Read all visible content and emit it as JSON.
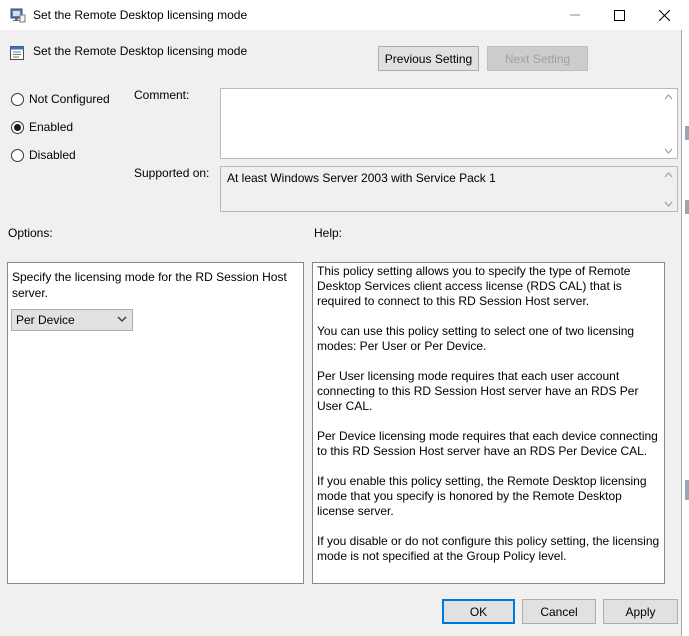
{
  "window": {
    "title": "Set the Remote Desktop licensing mode",
    "controls": {
      "minimize": "—",
      "maximize": "□",
      "close": "✕"
    }
  },
  "header": {
    "title": "Set the Remote Desktop licensing mode",
    "previous_label": "Previous Setting",
    "next_label": "Next Setting"
  },
  "state": {
    "options": [
      "Not Configured",
      "Enabled",
      "Disabled"
    ],
    "selected": "Enabled"
  },
  "comment": {
    "label": "Comment:",
    "value": ""
  },
  "supported": {
    "label": "Supported on:",
    "value": "At least Windows Server 2003 with Service Pack 1"
  },
  "options_section": {
    "label": "Options:",
    "description": "Specify the licensing mode for the RD Session Host server.",
    "mode_selected": "Per Device"
  },
  "help_section": {
    "label": "Help:",
    "paragraphs": [
      "This policy setting allows you to specify the type of Remote Desktop Services client access license (RDS CAL) that is required to connect to this RD Session Host server.",
      "You can use this policy setting to select one of two licensing modes: Per User or Per Device.",
      "Per User licensing mode requires that each user account connecting to this RD Session Host server have an RDS Per User CAL.",
      "Per Device licensing mode requires that each device connecting to this RD Session Host server have an RDS Per Device CAL.",
      "If you enable this policy setting, the Remote Desktop licensing mode that you specify is honored by the Remote Desktop license server.",
      "If you disable or do not configure this policy setting, the licensing mode is not specified at the Group Policy level."
    ]
  },
  "footer": {
    "ok_label": "OK",
    "cancel_label": "Cancel",
    "apply_label": "Apply"
  },
  "colors": {
    "accent": "#0078d7",
    "dialog_bg": "#f0f0f0",
    "button_bg": "#e1e1e1"
  }
}
